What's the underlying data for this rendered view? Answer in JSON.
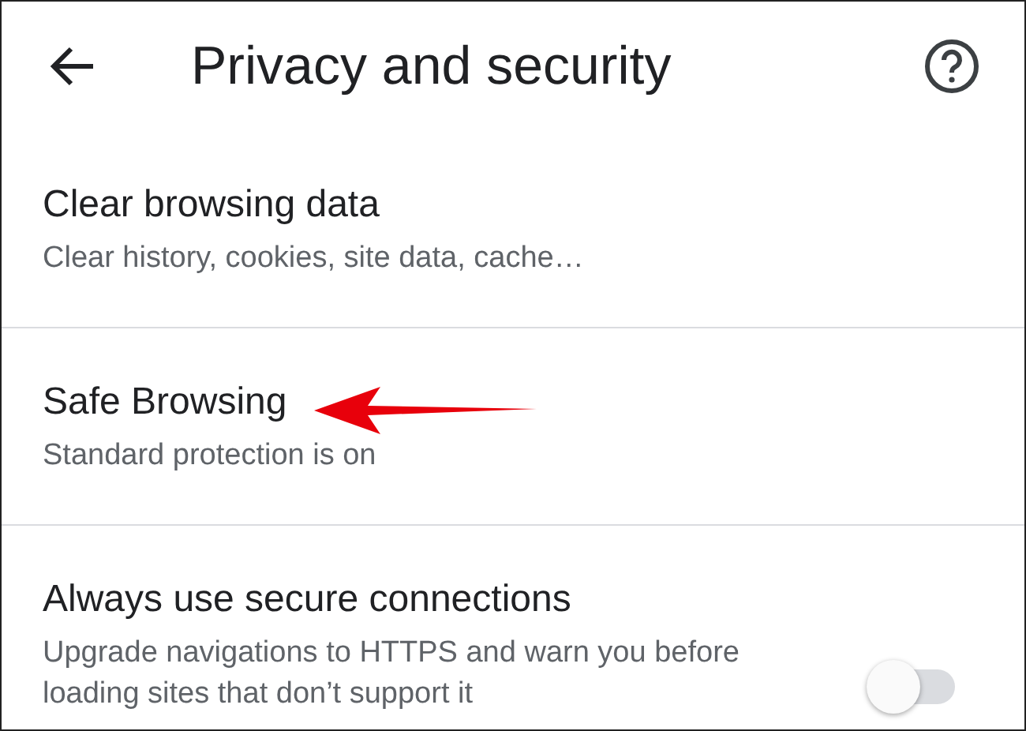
{
  "header": {
    "title": "Privacy and security"
  },
  "items": [
    {
      "kind": "link",
      "title": "Clear browsing data",
      "subtitle": "Clear history, cookies, site data, cache…"
    },
    {
      "kind": "link",
      "title": "Safe Browsing",
      "subtitle": "Standard protection is on"
    },
    {
      "kind": "toggle",
      "title": "Always use secure connections",
      "subtitle": "Upgrade navigations to HTTPS and warn you before loading sites that don’t support it",
      "on": false
    }
  ]
}
